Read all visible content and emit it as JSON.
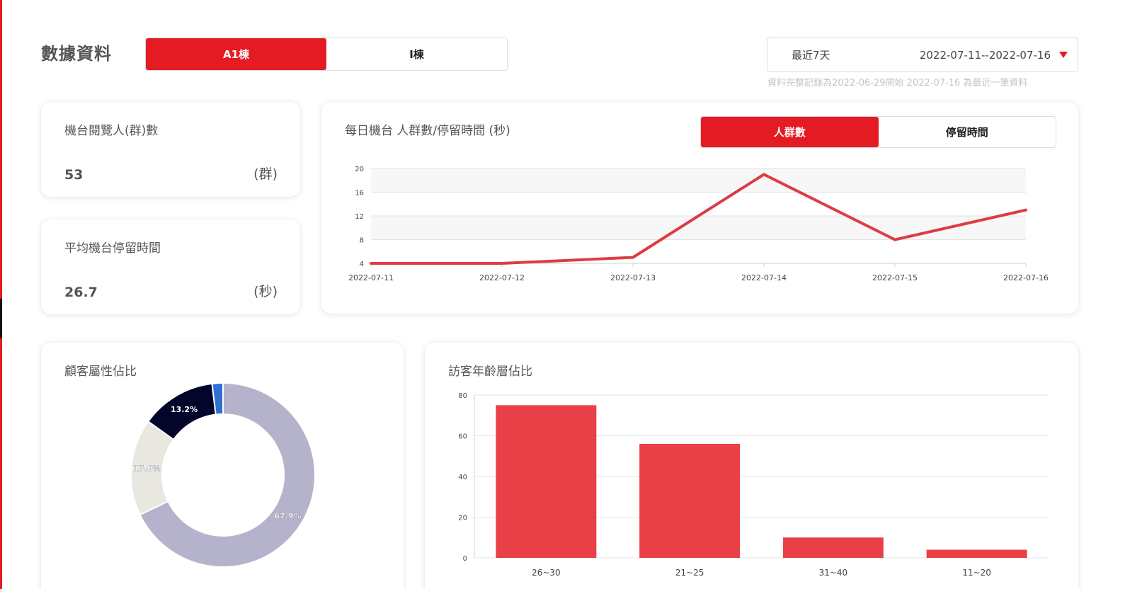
{
  "header": {
    "title": "數據資料",
    "building_tabs": [
      {
        "label": "A1棟",
        "active": true
      },
      {
        "label": "I棟",
        "active": false
      }
    ],
    "date_filter": {
      "preset": "最近7天",
      "range": "2022-07-11--2022-07-16"
    },
    "date_note": "資料完整記錄為2022-06-29開始  2022-07-16 為最近一筆資料"
  },
  "stats": {
    "visitors": {
      "title": "機台閱覽人(群)數",
      "value": "53",
      "unit": "(群)"
    },
    "dwell": {
      "title": "平均機台停留時間",
      "value": "26.7",
      "unit": "(秒)"
    }
  },
  "daily_panel": {
    "title": "每日機台 人群數/停留時間 (秒)",
    "tabs": [
      {
        "label": "人群數",
        "active": true
      },
      {
        "label": "停留時間",
        "active": false
      }
    ]
  },
  "gender_panel": {
    "title": "顧客屬性佔比"
  },
  "age_panel": {
    "title": "訪客年齡層佔比"
  },
  "colors": {
    "accent": "#e51b24",
    "line": "#dd3c44",
    "bar": "#e8363d"
  },
  "chart_data": [
    {
      "type": "line",
      "x": [
        "2022-07-11",
        "2022-07-12",
        "2022-07-13",
        "2022-07-14",
        "2022-07-15",
        "2022-07-16"
      ],
      "series": [
        {
          "values": [
            4,
            4,
            5,
            19,
            8,
            13
          ]
        }
      ],
      "yticks": [
        4,
        8,
        12,
        16,
        20
      ],
      "ylim": [
        4,
        20
      ],
      "grid": true
    },
    {
      "type": "pie",
      "donut": true,
      "slices": [
        {
          "value": 67.9,
          "label": "67.9%",
          "color": "#b5b3cb"
        },
        {
          "value": 17.0,
          "label": "17.0%",
          "color": "#e8e8e0"
        },
        {
          "value": 13.2,
          "label": "13.2%",
          "color": "#04052a"
        },
        {
          "value": 1.9,
          "label": "",
          "color": "#2f6fd6"
        }
      ]
    },
    {
      "type": "bar",
      "categories": [
        "26~30",
        "21~25",
        "31~40",
        "11~20"
      ],
      "values": [
        75,
        56,
        10,
        4
      ],
      "yticks": [
        0,
        20,
        40,
        60,
        80
      ],
      "ylim": [
        0,
        80
      ],
      "grid": true
    }
  ]
}
